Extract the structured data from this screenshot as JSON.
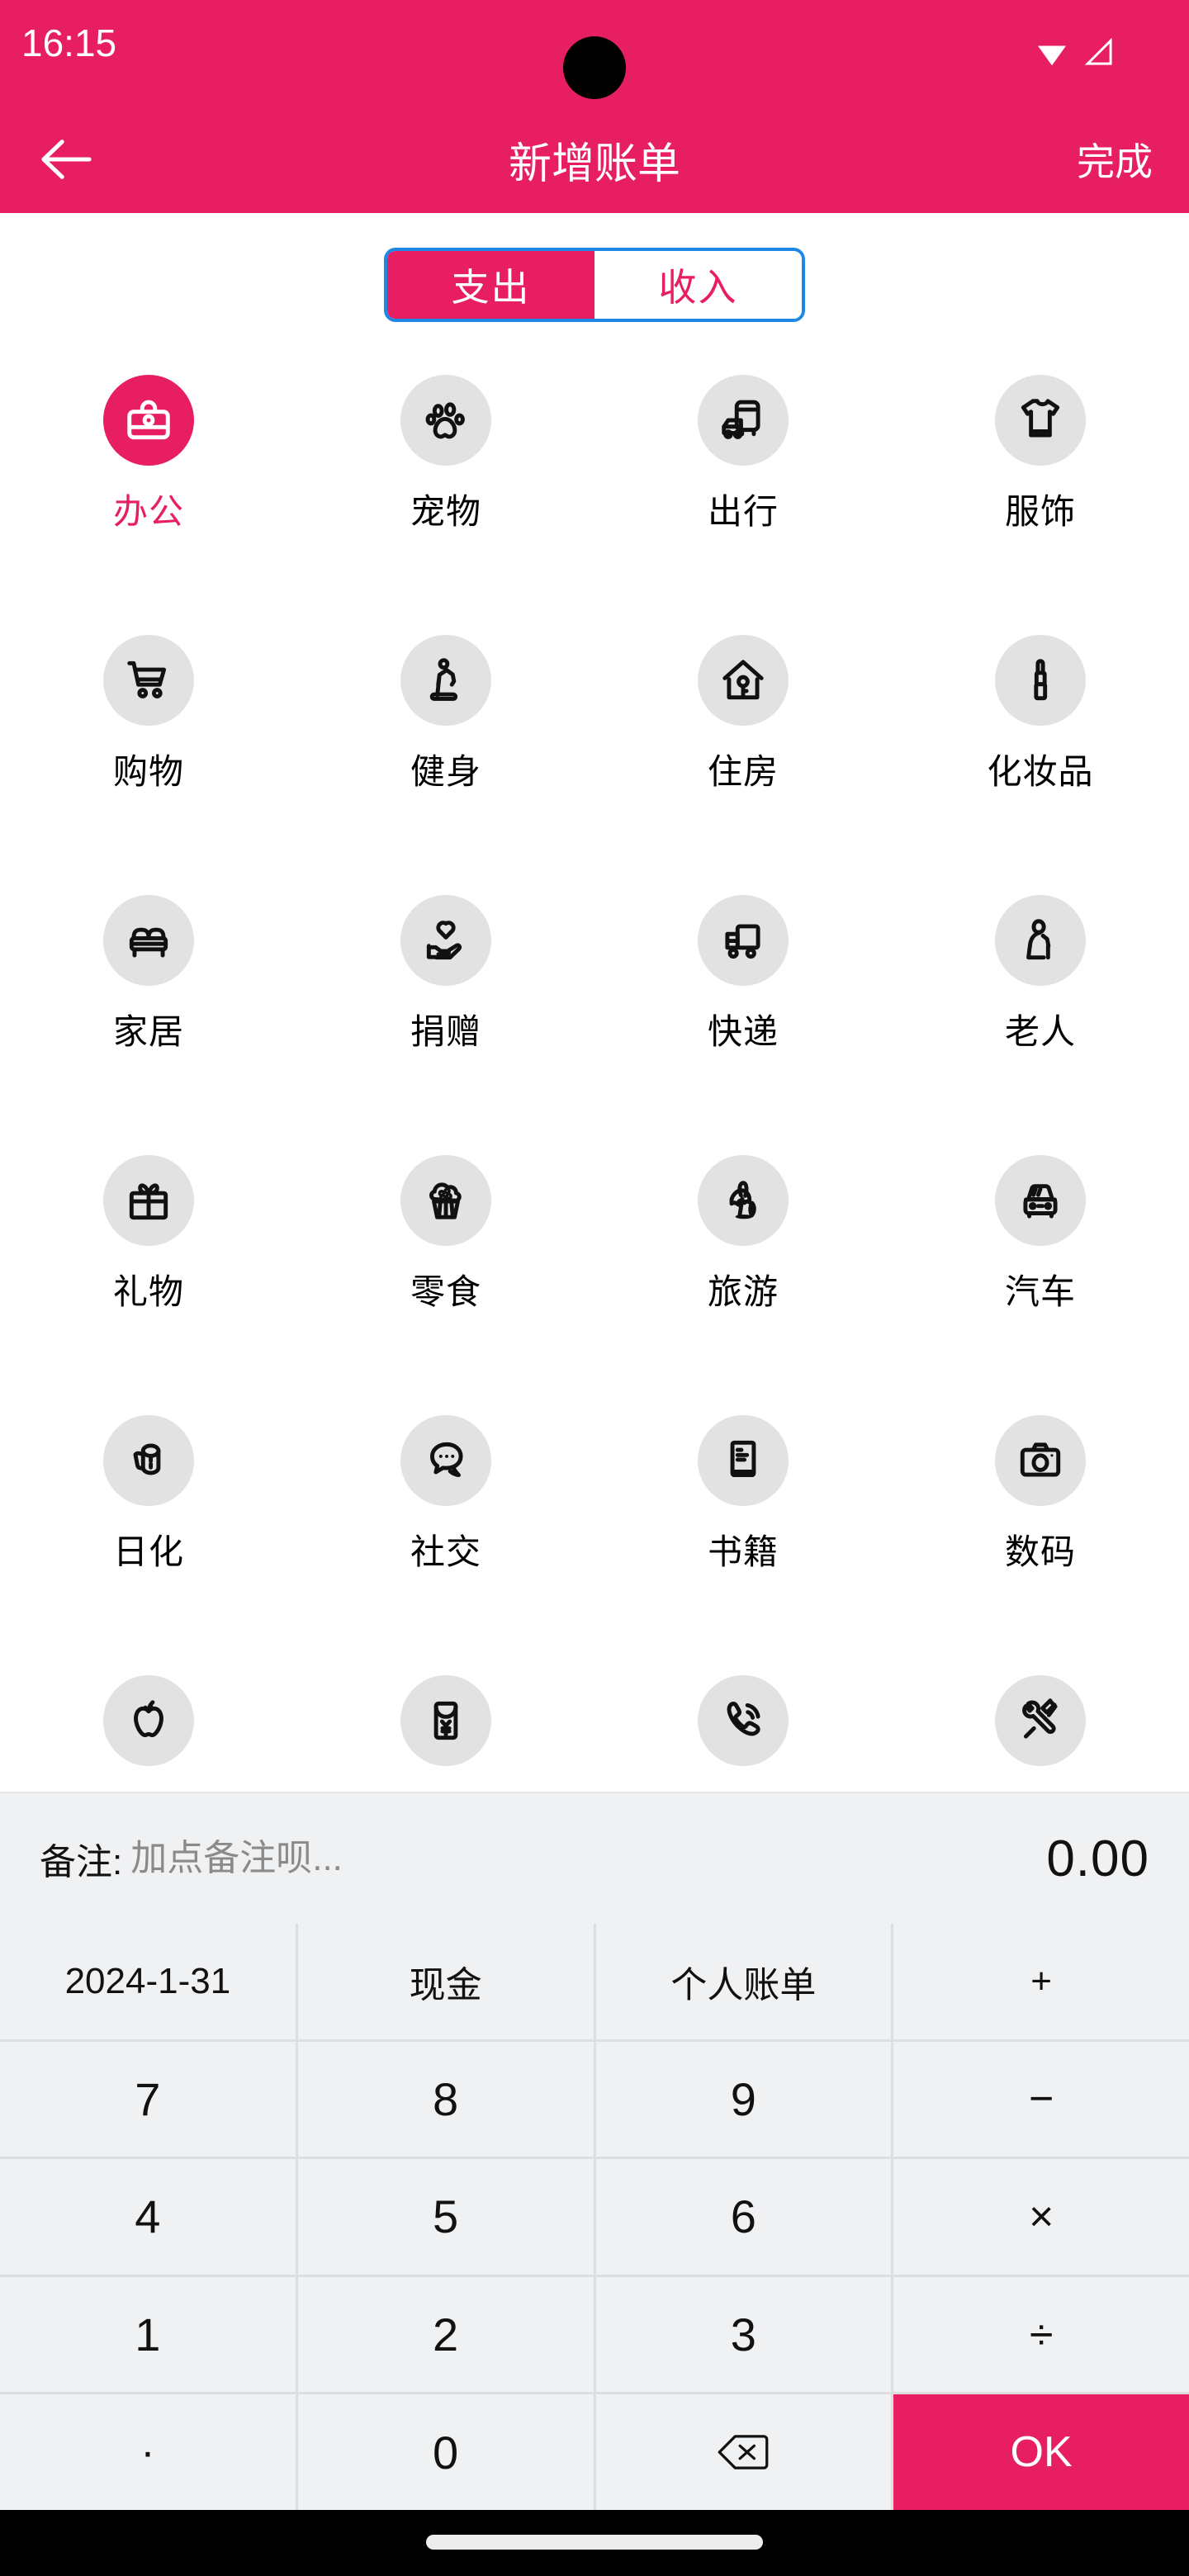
{
  "status_bar": {
    "time": "16:15",
    "wifi_icon": "wifi-icon",
    "signal_icon": "signal-icon"
  },
  "header": {
    "back_icon": "back-arrow-icon",
    "title": "新增账单",
    "done_label": "完成",
    "background_color": "#E81E63"
  },
  "segment": {
    "border_color": "#1E88E5",
    "items": [
      {
        "label": "支出",
        "active": true
      },
      {
        "label": "收入",
        "active": false
      }
    ]
  },
  "categories": {
    "selected_color": "#E81E63",
    "circle_color": "#E2E2E2",
    "items": [
      {
        "label": "办公",
        "icon": "briefcase-icon",
        "selected": true
      },
      {
        "label": "宠物",
        "icon": "paw-icon",
        "selected": false
      },
      {
        "label": "出行",
        "icon": "bus-car-icon",
        "selected": false
      },
      {
        "label": "服饰",
        "icon": "tshirt-icon",
        "selected": false
      },
      {
        "label": "购物",
        "icon": "shopping-cart-icon",
        "selected": false
      },
      {
        "label": "健身",
        "icon": "treadmill-icon",
        "selected": false
      },
      {
        "label": "住房",
        "icon": "house-key-icon",
        "selected": false
      },
      {
        "label": "化妆品",
        "icon": "lipstick-icon",
        "selected": false
      },
      {
        "label": "家居",
        "icon": "sofa-icon",
        "selected": false
      },
      {
        "label": "捐赠",
        "icon": "heart-hand-icon",
        "selected": false
      },
      {
        "label": "快递",
        "icon": "delivery-truck-icon",
        "selected": false
      },
      {
        "label": "老人",
        "icon": "elderly-icon",
        "selected": false
      },
      {
        "label": "礼物",
        "icon": "gift-icon",
        "selected": false
      },
      {
        "label": "零食",
        "icon": "cupcake-icon",
        "selected": false
      },
      {
        "label": "旅游",
        "icon": "beach-umbrella-icon",
        "selected": false
      },
      {
        "label": "汽车",
        "icon": "car-icon",
        "selected": false
      },
      {
        "label": "日化",
        "icon": "toilet-paper-icon",
        "selected": false
      },
      {
        "label": "社交",
        "icon": "chat-bubble-icon",
        "selected": false
      },
      {
        "label": "书籍",
        "icon": "book-icon",
        "selected": false
      },
      {
        "label": "数码",
        "icon": "camera-icon",
        "selected": false
      },
      {
        "label": "",
        "icon": "apple-icon",
        "selected": false
      },
      {
        "label": "",
        "icon": "red-envelope-icon",
        "selected": false
      },
      {
        "label": "",
        "icon": "phone-icon",
        "selected": false
      },
      {
        "label": "",
        "icon": "tools-icon",
        "selected": false
      }
    ]
  },
  "note_bar": {
    "label": "备注:",
    "placeholder": "加点备注呗...",
    "value": "",
    "amount": "0.00"
  },
  "keypad": {
    "meta_row": [
      {
        "label": "2024-1-31",
        "name": "date-key"
      },
      {
        "label": "现金",
        "name": "account-key"
      },
      {
        "label": "个人账单",
        "name": "ledger-key"
      },
      {
        "label": "+",
        "name": "add-key"
      }
    ],
    "rows": [
      [
        {
          "label": "7"
        },
        {
          "label": "8"
        },
        {
          "label": "9"
        },
        {
          "label": "−"
        }
      ],
      [
        {
          "label": "4"
        },
        {
          "label": "5"
        },
        {
          "label": "6"
        },
        {
          "label": "×"
        }
      ],
      [
        {
          "label": "1"
        },
        {
          "label": "2"
        },
        {
          "label": "3"
        },
        {
          "label": "÷"
        }
      ],
      [
        {
          "label": "·"
        },
        {
          "label": "0"
        },
        {
          "label": ""
        },
        {
          "label": "OK"
        }
      ]
    ],
    "backspace_icon": "backspace-icon",
    "ok_color": "#E81E63"
  }
}
